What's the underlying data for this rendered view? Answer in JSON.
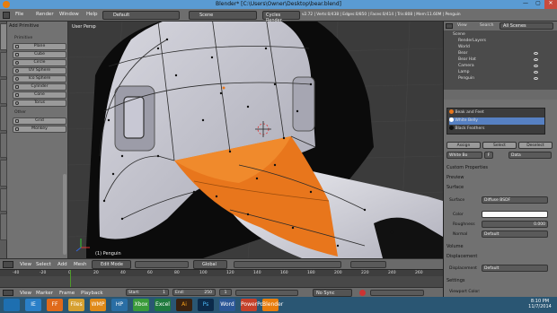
{
  "window": {
    "title": "Blender* [C:\\Users\\Owner\\Desktop\\bear.blend]",
    "minimize": "—",
    "maximize": "▢",
    "close": "✕"
  },
  "top_menu": {
    "items": [
      "File",
      "Render",
      "Window",
      "Help"
    ],
    "layout": "Default",
    "scene": "Scene",
    "engine": "Cycles Render",
    "stats": "v2.72 | Verts:0/438 | Edges:0/850 | Faces:0/414 | Tris:808 | Mem:11.60M | Penguin"
  },
  "toolshelf": {
    "header": "Add Primitive",
    "section_mesh": "Primitive",
    "mesh_buttons": [
      "Plane",
      "Cube",
      "Circle",
      "UV Sphere",
      "Ico Sphere",
      "Cylinder",
      "Cone",
      "Torus"
    ],
    "section_other": "Other",
    "other_buttons": [
      "Grid",
      "Monkey"
    ],
    "tabs": [
      "Tools",
      "Create",
      "Relations",
      "Animation",
      "Physics",
      "Shading / UVs",
      "Options",
      "Grease Pencil"
    ]
  },
  "viewport": {
    "label": "User Persp",
    "object_label": "(1) Penguin"
  },
  "viewport_header": {
    "items": [
      "View",
      "Select",
      "Add",
      "Mesh"
    ],
    "mode": "Edit Mode",
    "pivot": "Global"
  },
  "timeline": {
    "ticks": [
      "-40",
      "-20",
      "0",
      "20",
      "40",
      "60",
      "80",
      "100",
      "120",
      "140",
      "160",
      "180",
      "200",
      "220",
      "240",
      "260"
    ],
    "header_items": [
      "View",
      "Marker",
      "Frame",
      "Playback"
    ],
    "start": "Start:",
    "start_val": "1",
    "end": "End:",
    "end_val": "250",
    "current": "1",
    "sync": "No Sync"
  },
  "outliner": {
    "view": "View",
    "search": "Search",
    "filter": "All Scenes",
    "items": [
      "Scene",
      "RenderLayers",
      "World",
      "Bear",
      "Bear Hat",
      "Camera",
      "Lamp",
      "Penguin"
    ]
  },
  "properties": {
    "materials": [
      "Beak and Feet",
      "White Belly",
      "Black Feathers"
    ],
    "selected_material": "White Belly",
    "assign": "Assign",
    "select": "Select",
    "deselect": "Deselect",
    "mat_name": "White Bo",
    "mat_f": "F",
    "data": "Data",
    "sections": [
      "Custom Properties",
      "Preview",
      "Surface"
    ],
    "surface_label": "Surface",
    "surface_value": "Diffuse BSDF",
    "color_label": "Color",
    "roughness_label": "Roughness",
    "roughness_value": "0.000",
    "normal_label": "Normal",
    "normal_value": "Default",
    "volume": "Volume",
    "displacement": "Displacement",
    "displacement_label": "Displacement",
    "displacement_value": "Default",
    "settings": "Settings",
    "viewport_color": "Viewport Color:"
  },
  "taskbar": {
    "apps": [
      "IE",
      "FF",
      "Files",
      "WMP",
      "HP",
      "Xbox",
      "Excel",
      "Ai",
      "Ps",
      "Word",
      "PowerPoint",
      "Blender"
    ],
    "time": "8:10 PM",
    "date": "11/7/2014"
  },
  "colors": {
    "beak": "#e8761c",
    "selected": "#5680c2",
    "title_bar": "#5a9bd3",
    "taskbar": "#2a5673"
  }
}
